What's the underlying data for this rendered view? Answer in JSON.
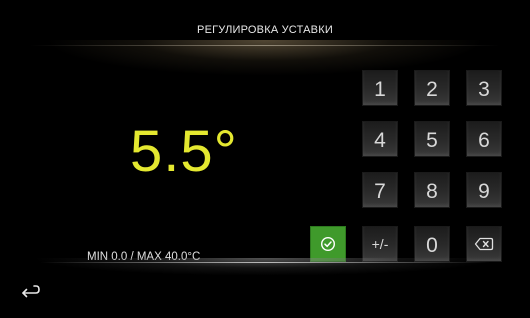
{
  "header": {
    "title": "РЕГУЛИРОВКА УСТАВКИ"
  },
  "setpoint": {
    "value": "5.5°"
  },
  "range": {
    "text": "MIN  0.0 / MAX  40.0°C"
  },
  "keypad": {
    "keys": [
      {
        "label": "1",
        "name": "key-1"
      },
      {
        "label": "2",
        "name": "key-2"
      },
      {
        "label": "3",
        "name": "key-3"
      },
      {
        "label": "4",
        "name": "key-4"
      },
      {
        "label": "5",
        "name": "key-5"
      },
      {
        "label": "6",
        "name": "key-6"
      },
      {
        "label": "7",
        "name": "key-7"
      },
      {
        "label": "8",
        "name": "key-8"
      },
      {
        "label": "9",
        "name": "key-9"
      },
      {
        "label": "+/-",
        "name": "key-sign"
      },
      {
        "label": "0",
        "name": "key-0"
      }
    ],
    "confirm_icon": "check-circle-icon",
    "backspace_icon": "backspace-icon"
  },
  "navigation": {
    "back_icon": "back-arrow-icon"
  },
  "colors": {
    "value_yellow": "#e4e830",
    "confirm_green": "#3f9a2b",
    "background": "#000000"
  }
}
